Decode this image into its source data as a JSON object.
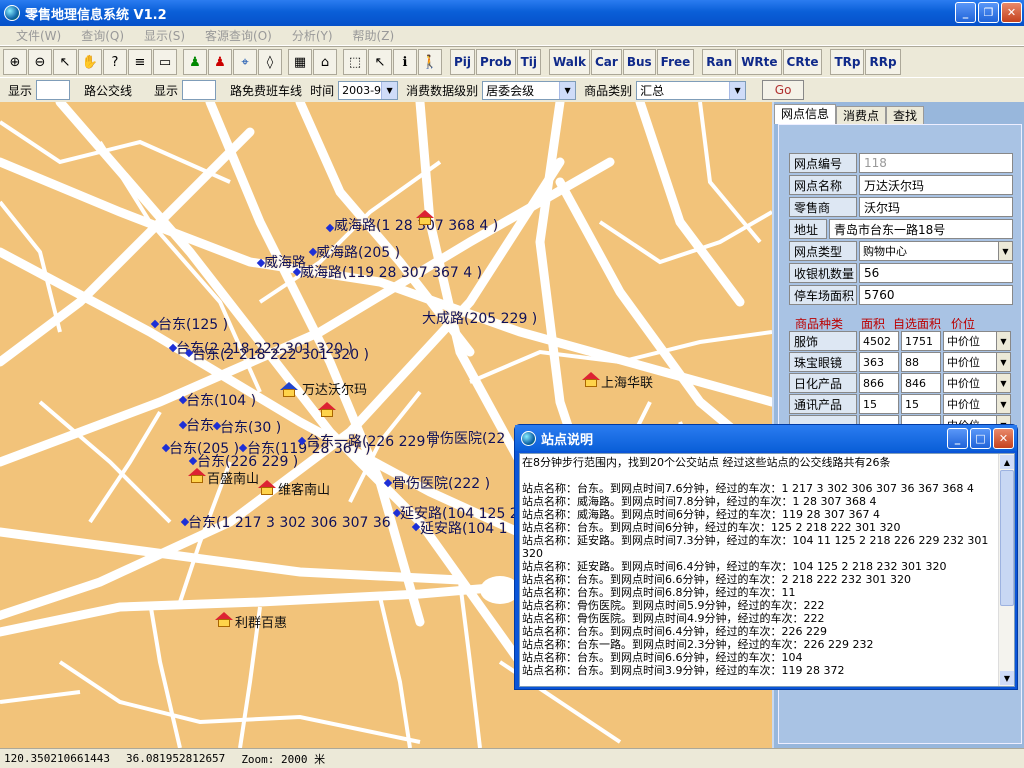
{
  "title": "零售地理信息系统 V1.2",
  "menu": [
    "文件(W)",
    "查询(Q)",
    "显示(S)",
    "客源查询(O)",
    "分析(Y)",
    "帮助(Z)"
  ],
  "toolbar": {
    "icons": [
      "zoom-in-icon",
      "zoom-out-icon",
      "select-arrow-icon",
      "pan-hand-icon",
      "help-pointer-icon",
      "layers-icon",
      "map-frame-icon",
      "person-green-icon",
      "person-red-icon",
      "pin-icon",
      "eraser-icon",
      "table-icon",
      "building-icon",
      "select-box-icon",
      "arrow-icon",
      "info-icon",
      "walk-person-icon"
    ],
    "text_buttons": [
      "Pij",
      "Prob",
      "Tij",
      "Walk",
      "Car",
      "Bus",
      "Free",
      "Ran",
      "WRte",
      "CRte",
      "TRp",
      "RRp"
    ]
  },
  "options": {
    "show1": "显示",
    "bus_label": "路公交线",
    "show2": "显示",
    "free_label": "路免费班车线",
    "time_label": "时间",
    "time_value": "2003-9",
    "level_label": "消费数据级别",
    "level_value": "居委会级",
    "category_label": "商品类别",
    "category_value": "汇总",
    "go": "Go"
  },
  "map": {
    "labels": [
      "威海路(1 28 307 368 4 )",
      "威海路(205 )",
      "威海路",
      "威海路(119 28 307 367 4 )",
      "大成路(205 229 )",
      "台东(125 )",
      "台东(2 218 222 301 320 )",
      "台东(2 218 222 301 320 )",
      "台东(104 )",
      "台东(30 )",
      "台东",
      "台东(205 )",
      "台东(119 28 367 )",
      "台东一路(226 229 )",
      "骨伤医院(22",
      "台东(226 229 )",
      "骨伤医院(222 )",
      "延安路(104 125 2",
      "延安路(104 1",
      "台东(1 217 3 302 306 307 36",
      "上海华联",
      "万达沃尔玛",
      "百盛南山",
      "维客南山",
      "利群百惠"
    ]
  },
  "panel": {
    "tabs": [
      "网点信息",
      "消费点",
      "查找"
    ],
    "fields": [
      {
        "label": "网点编号",
        "value": "118"
      },
      {
        "label": "网点名称",
        "value": "万达沃尔玛"
      },
      {
        "label": "零售商",
        "value": "沃尔玛"
      },
      {
        "label": "地址",
        "value": "青岛市台东一路18号"
      },
      {
        "label": "网点类型",
        "value": "购物中心"
      },
      {
        "label": "收银机数量",
        "value": "56"
      },
      {
        "label": "停车场面积",
        "value": "5760"
      }
    ],
    "cat_headers": [
      "商品种类",
      "面积",
      "自选面积",
      "价位"
    ],
    "cats": [
      {
        "name": "服饰",
        "area": "4502",
        "self": "1751",
        "price": "中价位"
      },
      {
        "name": "珠宝眼镜",
        "area": "363",
        "self": "88",
        "price": "中价位"
      },
      {
        "name": "日化产品",
        "area": "866",
        "self": "846",
        "price": "中价位"
      },
      {
        "name": "通讯产品",
        "area": "15",
        "self": "15",
        "price": "中价位"
      },
      {
        "name": "",
        "area": "",
        "self": "",
        "price": "中价位"
      }
    ]
  },
  "popup": {
    "title": "站点说明",
    "text": "在8分钟步行范围内，找到20个公交站点 经过这些站点的公交线路共有26条\n\n站点名称：台东。到网点时间7.6分钟，经过的车次：1 217 3 302 306 307 36 367 368 4\n站点名称：威海路。到网点时间7.8分钟，经过的车次：1 28 307 368 4\n站点名称：威海路。到网点时间6分钟，经过的车次：119 28 307 367 4\n站点名称：台东。到网点时间6分钟，经过的车次：125 2 218 222 301 320\n站点名称：延安路。到网点时间7.3分钟，经过的车次：104 11 125 2 218 226 229 232 301 320\n站点名称：延安路。到网点时间6.4分钟，经过的车次：104 125 2 218 232 301 320\n站点名称：台东。到网点时间6.6分钟，经过的车次：2 218 222 232 301 320\n站点名称：台东。到网点时间6.8分钟，经过的车次：11\n站点名称：骨伤医院。到网点时间5.9分钟，经过的车次：222\n站点名称：骨伤医院。到网点时间4.9分钟，经过的车次：222\n站点名称：台东。到网点时间6.4分钟，经过的车次：226 229\n站点名称：台东一路。到网点时间2.3分钟，经过的车次：226 229 232\n站点名称：台东。到网点时间6.6分钟，经过的车次：104\n站点名称：台东。到网点时间3.9分钟，经过的车次：119 28 372"
  },
  "status": {
    "x": "120.350210661443",
    "y": "36.081952812657",
    "zoom": "Zoom:  2000 米"
  }
}
